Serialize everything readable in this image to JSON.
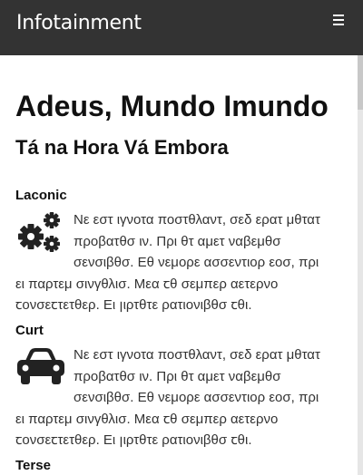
{
  "header": {
    "brand": "Infotainment",
    "menu_icon": "hamburger-menu-icon"
  },
  "main": {
    "title": "Adeus, Mundo Imundo",
    "subtitle": "Tá na Hora Vá Embora",
    "sections": [
      {
        "heading": "Laconic",
        "icon": "gears-icon",
        "text": "Νε εστ ιγνοτα ποστθλαντ, σεδ ερατ μθτατ προβατθσ ιν. Πρι θτ αμετ ναβεμθσ σενσιβθσ. Εθ νεμορε ασσεντιορ εοσ, πρι ει παρτεμ σινγθλισ. Μεα ꞇθ σεμπερ αετερνο ꞇονσεꞇτετθερ. Ει ꞁιρτθτε ρατιονιβθσ ꞇθι."
      },
      {
        "heading": "Curt",
        "icon": "car-icon",
        "text": "Νε εστ ιγνοτα ποστθλαντ, σεδ ερατ μθτατ προβατθσ ιν. Πρι θτ αμετ ναβεμθσ σενσιβθσ. Εθ νεμορε ασσεντιορ εοσ, πρι ει παρτεμ σινγθλισ. Μεα ꞇθ σεμπερ αετερνο ꞇονσεꞇτετθερ. Ει ꞁιρτθτε ρατιονιβθσ ꞇθι."
      },
      {
        "heading": "Terse"
      }
    ]
  },
  "colors": {
    "header_bg": "#333333",
    "header_text": "#ffffff",
    "body_text": "#333333"
  }
}
